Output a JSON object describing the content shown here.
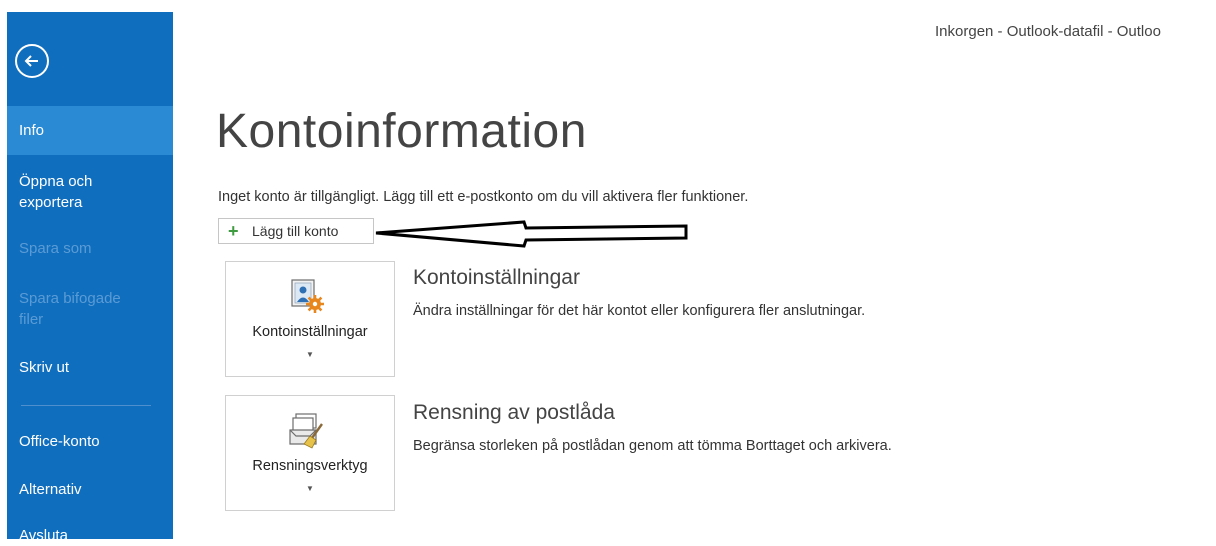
{
  "window": {
    "title": "Inkorgen - Outlook-datafil - Outloo"
  },
  "sidebar": {
    "items": [
      {
        "label": "Info",
        "state": "active"
      },
      {
        "label": "Öppna och exportera",
        "state": "normal"
      },
      {
        "label": "Spara som",
        "state": "disabled"
      },
      {
        "label": "Spara bifogade filer",
        "state": "disabled"
      },
      {
        "label": "Skriv ut",
        "state": "normal"
      },
      {
        "label": "Office-konto",
        "state": "normal"
      },
      {
        "label": "Alternativ",
        "state": "normal"
      },
      {
        "label": "Avsluta",
        "state": "normal"
      }
    ],
    "item_lines": {
      "open_line1": "Öppna och",
      "open_line2": "exportera",
      "attachments_line1": "Spara bifogade",
      "attachments_line2": "filer"
    }
  },
  "main": {
    "title": "Kontoinformation",
    "info_text": "Inget konto är tillgängligt. Lägg till ett e-postkonto om du vill aktivera fler funktioner.",
    "add_account_label": "Lägg till konto",
    "sections": [
      {
        "tile_label": "Kontoinställningar",
        "heading": "Kontoinställningar",
        "description": "Ändra inställningar för det här kontot eller konfigurera fler anslutningar.",
        "icon": "account-settings-icon"
      },
      {
        "tile_label": "Rensningsverktyg",
        "heading": "Rensning av postlåda",
        "description": "Begränsa storleken på postlådan genom att tömma Borttaget och arkivera.",
        "icon": "cleanup-tools-icon"
      }
    ]
  },
  "colors": {
    "sidebar": "#106ebe",
    "sidebar_active": "#2a8ad4",
    "sidebar_disabled_text": "#5a9bd5",
    "add_icon": "#3f9b3f"
  }
}
